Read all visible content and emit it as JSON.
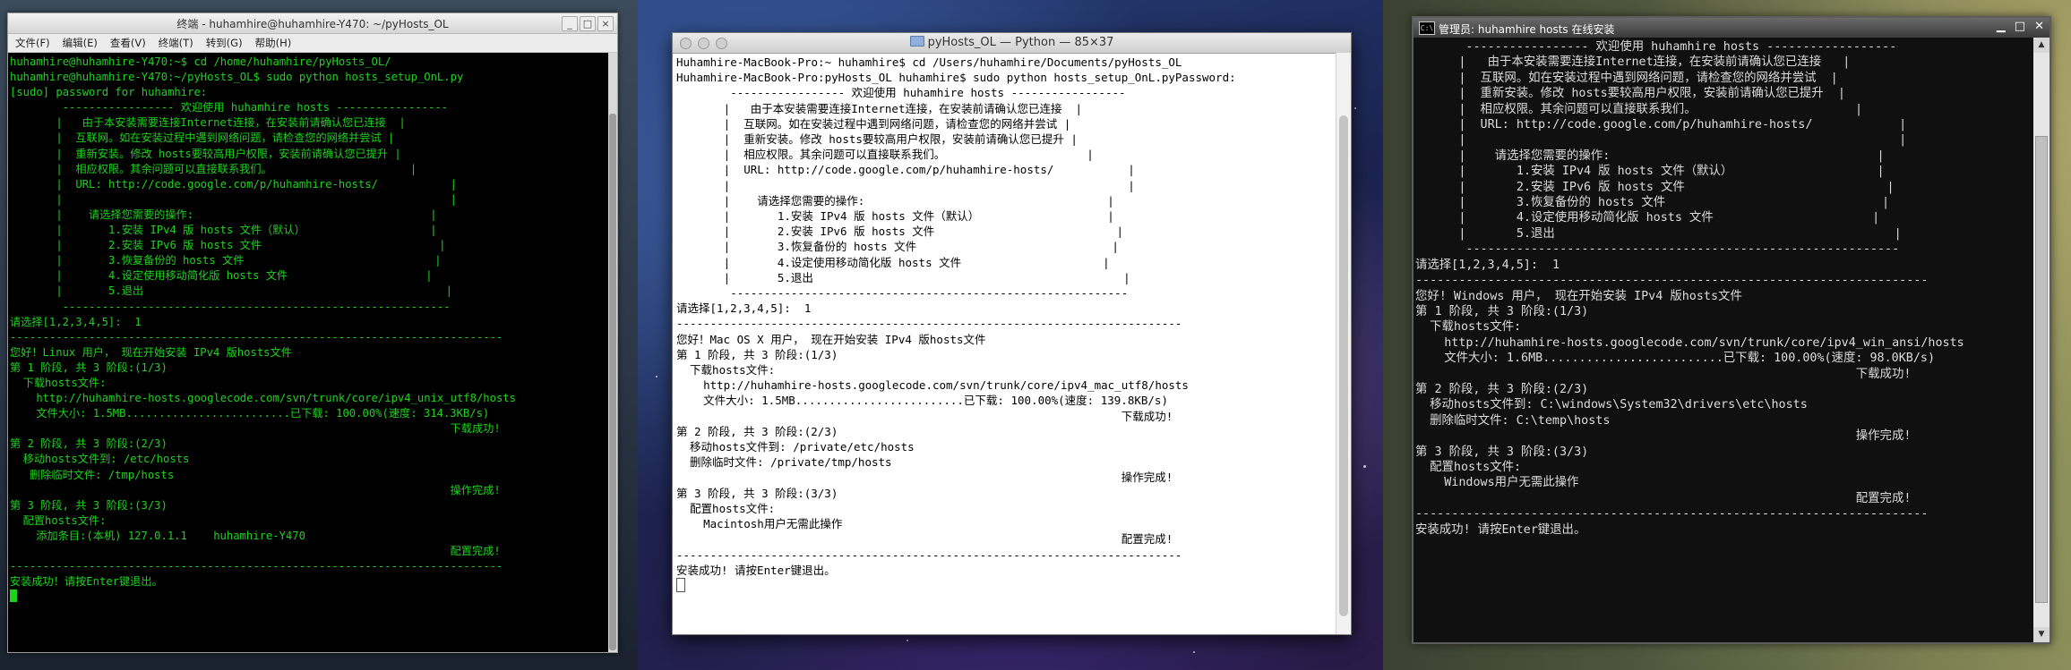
{
  "left_window": {
    "title": "终端 - huhamhire@huhamhire-Y470: ~/pyHosts_OL",
    "menu": [
      "文件(F)",
      "编辑(E)",
      "查看(V)",
      "终端(T)",
      "转到(G)",
      "帮助(H)"
    ],
    "lines": [
      "huhamhire@huhamhire-Y470:~$ cd /home/huhamhire/pyHosts_OL/",
      "huhamhire@huhamhire-Y470:~/pyHosts_OL$ sudo python hosts_setup_OnL.py",
      "[sudo] password for huhamhire:",
      "        ----------------- 欢迎使用 huhamhire hosts -----------------",
      "       |   由于本安装需要连接Internet连接，在安装前请确认您已连接  |",
      "       |  互联网。如在安装过程中遇到网络问题，请检查您的网络并尝试 |",
      "       |  重新安装。修改 hosts要较高用户权限，安装前请确认您已提升 |",
      "       |  相应权限。其余问题可以直接联系我们。                     |",
      "       |  URL: http://code.google.com/p/huhamhire-hosts/           |",
      "       |                                                           |",
      "       |    请选择您需要的操作:                                    |",
      "       |       1.安装 IPv4 版 hosts 文件（默认）                   |",
      "       |       2.安装 IPv6 版 hosts 文件                           |",
      "       |       3.恢复备份的 hosts 文件                             |",
      "       |       4.设定使用移动简化版 hosts 文件                     |",
      "       |       5.退出                                              |",
      "        -----------------------------------------------------------",
      "",
      "请选择[1,2,3,4,5]:  1",
      "---------------------------------------------------------------------------",
      "您好！Linux 用户， 现在开始安装 IPv4 版hosts文件",
      "",
      "第 1 阶段, 共 3 阶段:(1/3)",
      "  下载hosts文件:",
      "    http://huhamhire-hosts.googlecode.com/svn/trunk/core/ipv4_unix_utf8/hosts",
      "    文件大小: 1.5MB.........................已下载: 100.00%(速度: 314.3KB/s)",
      "                                                                   下载成功!",
      "第 2 阶段, 共 3 阶段:(2/3)",
      "  移动hosts文件到: /etc/hosts",
      "   删除临时文件: /tmp/hosts",
      "                                                                   操作完成!",
      "第 3 阶段, 共 3 阶段:(3/3)",
      "  配置hosts文件:",
      "    添加条目:(本机) 127.0.1.1    huhamhire-Y470",
      "                                                                   配置完成!",
      "---------------------------------------------------------------------------",
      "安装成功！请按Enter键退出。"
    ]
  },
  "mid_window": {
    "title": "pyHosts_OL — Python — 85×37",
    "lines": [
      "Huhamhire-MacBook-Pro:~ huhamhire$ cd /Users/huhamhire/Documents/pyHosts_OL",
      "Huhamhire-MacBook-Pro:pyHosts_OL huhamhire$ sudo python hosts_setup_OnL.pyPassword:",
      "        ----------------- 欢迎使用 huhamhire hosts -----------------",
      "       |   由于本安装需要连接Internet连接，在安装前请确认您已连接  |",
      "       |  互联网。如在安装过程中遇到网络问题，请检查您的网络并尝试 |",
      "       |  重新安装。修改 hosts要较高用户权限，安装前请确认您已提升 |",
      "       |  相应权限。其余问题可以直接联系我们。                     |",
      "       |  URL: http://code.google.com/p/huhamhire-hosts/           |",
      "       |                                                           |",
      "       |    请选择您需要的操作:                                    |",
      "       |       1.安装 IPv4 版 hosts 文件（默认）                   |",
      "       |       2.安装 IPv6 版 hosts 文件                           |",
      "       |       3.恢复备份的 hosts 文件                             |",
      "       |       4.设定使用移动简化版 hosts 文件                     |",
      "       |       5.退出                                              |",
      "        -----------------------------------------------------------",
      "",
      "请选择[1,2,3,4,5]:  1",
      "---------------------------------------------------------------------------",
      "您好！Mac OS X 用户， 现在开始安装 IPv4 版hosts文件",
      "",
      "第 1 阶段, 共 3 阶段:(1/3)",
      "  下载hosts文件:",
      "    http://huhamhire-hosts.googlecode.com/svn/trunk/core/ipv4_mac_utf8/hosts",
      "    文件大小: 1.5MB.........................已下载: 100.00%(速度: 139.8KB/s)",
      "                                                                  下载成功!",
      "第 2 阶段, 共 3 阶段:(2/3)",
      "  移动hosts文件到: /private/etc/hosts",
      "  删除临时文件: /private/tmp/hosts",
      "                                                                  操作完成!",
      "第 3 阶段, 共 3 阶段:(3/3)",
      "  配置hosts文件:",
      "    Macintosh用户无需此操作",
      "                                                                  配置完成!",
      "---------------------------------------------------------------------------",
      "安装成功! 请按Enter键退出。"
    ]
  },
  "right_window": {
    "title": "管理员: huhamhire hosts 在线安装",
    "lines": [
      "       ----------------- 欢迎使用 huhamhire hosts ------------------",
      "      |   由于本安装需要连接Internet连接，在安装前请确认您已连接   |",
      "      |  互联网。如在安装过程中遇到网络问题，请检查您的网络并尝试  |",
      "      |  重新安装。修改 hosts要较高用户权限，安装前请确认您已提升  |",
      "      |  相应权限。其余问题可以直接联系我们。                      |",
      "      |  URL: http://code.google.com/p/huhamhire-hosts/            |",
      "      |                                                            |",
      "      |    请选择您需要的操作:                                     |",
      "      |       1.安装 IPv4 版 hosts 文件（默认）                    |",
      "      |       2.安装 IPv6 版 hosts 文件                            |",
      "      |       3.恢复备份的 hosts 文件                              |",
      "      |       4.设定使用移动简化版 hosts 文件                      |",
      "      |       5.退出                                               |",
      "       ------------------------------------------------------------",
      "",
      "请选择[1,2,3,4,5]:  1",
      "-----------------------------------------------------------------------",
      "您好! Windows 用户， 现在开始安装 IPv4 版hosts文件",
      "",
      "第 1 阶段, 共 3 阶段:(1/3)",
      "  下载hosts文件:",
      "    http://huhamhire-hosts.googlecode.com/svn/trunk/core/ipv4_win_ansi/hosts",
      "    文件大小: 1.6MB.........................已下载: 100.00%(速度: 98.0KB/s)",
      "                                                             下载成功!",
      "第 2 阶段, 共 3 阶段:(2/3)",
      "  移动hosts文件到: C:\\windows\\System32\\drivers\\etc\\hosts",
      "  删除临时文件: C:\\temp\\hosts",
      "                                                             操作完成!",
      "第 3 阶段, 共 3 阶段:(3/3)",
      "  配置hosts文件:",
      "    Windows用户无需此操作",
      "                                                             配置完成!",
      "-----------------------------------------------------------------------",
      "安装成功! 请按Enter键退出。"
    ]
  },
  "colors": {
    "gnome_text": "#1ed21e",
    "mac_text": "#000000",
    "win_text": "#dcdcdc"
  }
}
